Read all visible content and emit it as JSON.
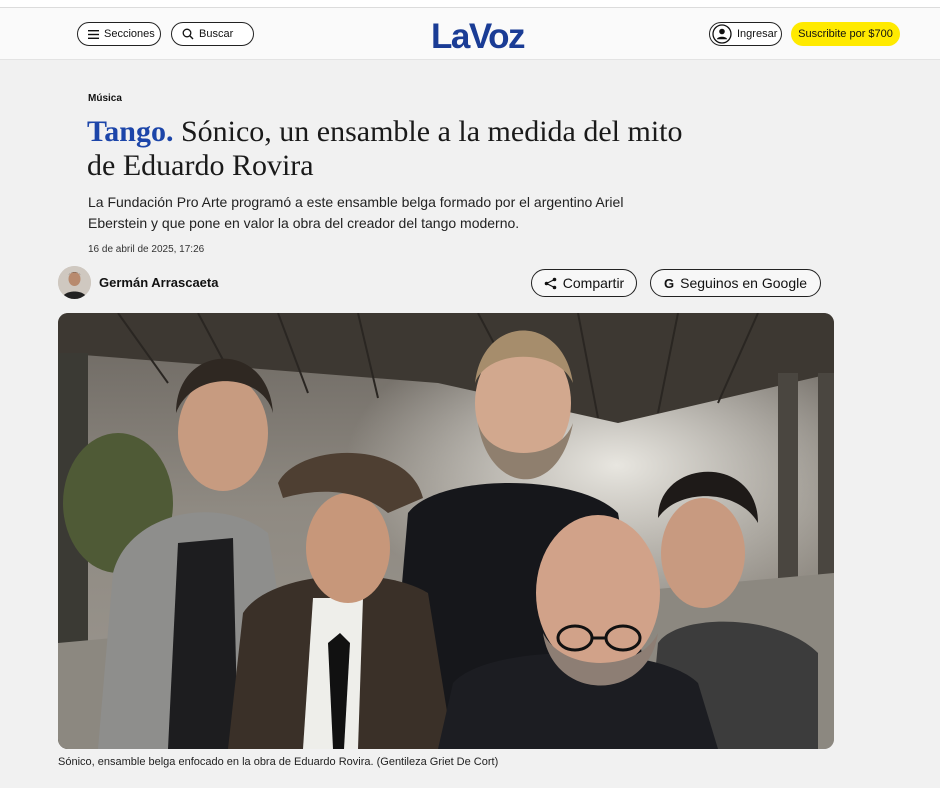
{
  "header": {
    "sections_label": "Secciones",
    "search_label": "Buscar",
    "logo_text": "LaVoz",
    "login_label": "Ingresar",
    "subscribe_label": "Suscribite por $700",
    "brand_color": "#1a3c95",
    "subscribe_color": "#ffea00"
  },
  "article": {
    "section": "Música",
    "kicker": "Tango.",
    "title": "Sónico, un ensamble a la medida del mito de Eduardo Rovira",
    "summary": "La Fundación Pro Arte programó a este ensamble belga formado por el argentino Ariel Eberstein y que pone en valor la obra del creador del tango moderno.",
    "date": "16 de abril de 2025, 17:26",
    "author": "Germán Arrascaeta",
    "share_label": "Compartir",
    "google_label": "Seguinos en Google",
    "caption": "Sónico, ensamble belga enfocado en la obra de Eduardo Rovira. (Gentileza Griet De Cort)"
  },
  "icons": {
    "menu": "menu-icon",
    "search": "search-icon",
    "user": "user-icon",
    "share": "share-icon",
    "google": "google-icon"
  }
}
